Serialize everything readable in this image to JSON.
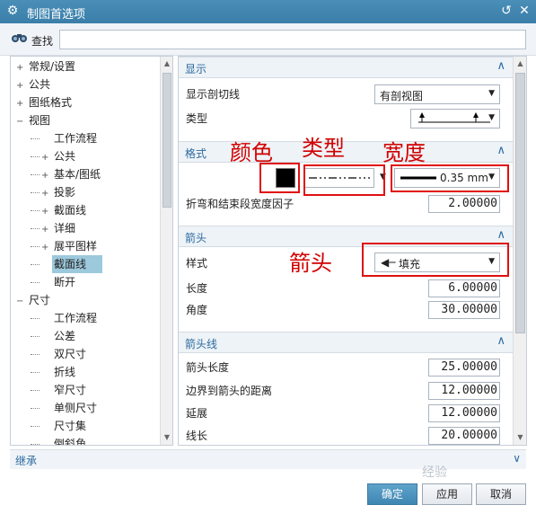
{
  "window": {
    "title": "制图首选项",
    "icons": {
      "app": "gear-icon",
      "reset": "reset-icon",
      "close": "close-icon"
    }
  },
  "find": {
    "label": "查找",
    "icon": "binoculars-icon",
    "value": ""
  },
  "tree": {
    "items": [
      {
        "label": "常规/设置",
        "toggle": "+",
        "indent": 0
      },
      {
        "label": "公共",
        "toggle": "+",
        "indent": 0
      },
      {
        "label": "图纸格式",
        "toggle": "+",
        "indent": 0
      },
      {
        "label": "视图",
        "toggle": "−",
        "indent": 0
      },
      {
        "label": "工作流程",
        "toggle": "",
        "indent": 1
      },
      {
        "label": "公共",
        "toggle": "+",
        "indent": 1
      },
      {
        "label": "基本/图纸",
        "toggle": "+",
        "indent": 1
      },
      {
        "label": "投影",
        "toggle": "+",
        "indent": 1
      },
      {
        "label": "截面线",
        "toggle": "+",
        "indent": 1
      },
      {
        "label": "详细",
        "toggle": "+",
        "indent": 1
      },
      {
        "label": "展平图样",
        "toggle": "+",
        "indent": 1
      },
      {
        "label": "截面线",
        "toggle": "",
        "indent": 1,
        "selected": true
      },
      {
        "label": "断开",
        "toggle": "",
        "indent": 1
      },
      {
        "label": "尺寸",
        "toggle": "−",
        "indent": 0
      },
      {
        "label": "工作流程",
        "toggle": "",
        "indent": 1
      },
      {
        "label": "公差",
        "toggle": "",
        "indent": 1
      },
      {
        "label": "双尺寸",
        "toggle": "",
        "indent": 1
      },
      {
        "label": "折线",
        "toggle": "",
        "indent": 1
      },
      {
        "label": "窄尺寸",
        "toggle": "",
        "indent": 1
      },
      {
        "label": "单侧尺寸",
        "toggle": "",
        "indent": 1
      },
      {
        "label": "尺寸集",
        "toggle": "",
        "indent": 1
      },
      {
        "label": "倒斜角",
        "toggle": "",
        "indent": 1
      }
    ]
  },
  "inherit": {
    "label": "继承"
  },
  "display": {
    "header": "显示",
    "show_cut_line": {
      "label": "显示剖切线",
      "value": "有剖视图"
    },
    "type": {
      "label": "类型"
    }
  },
  "format": {
    "header": "格式",
    "color": "#000000",
    "width_value": "0.35 mm",
    "factor": {
      "label": "折弯和结束段宽度因子",
      "value": "2.00000"
    }
  },
  "arrow": {
    "header": "箭头",
    "style": {
      "label": "样式",
      "value": "填充"
    },
    "length": {
      "label": "长度",
      "value": "6.00000"
    },
    "angle": {
      "label": "角度",
      "value": "30.00000"
    }
  },
  "arrow_line": {
    "header": "箭头线",
    "arrow_length": {
      "label": "箭头长度",
      "value": "25.00000"
    },
    "border_dist": {
      "label": "边界到箭头的距离",
      "value": "12.00000"
    },
    "extend": {
      "label": "延展",
      "value": "12.00000"
    },
    "line_length": {
      "label": "线长",
      "value": "20.00000"
    }
  },
  "annotations": {
    "color": "颜色",
    "type": "类型",
    "width": "宽度",
    "arrow": "箭头"
  },
  "buttons": {
    "ok": "确定",
    "apply": "应用",
    "cancel": "取消"
  },
  "watermark": "经验"
}
